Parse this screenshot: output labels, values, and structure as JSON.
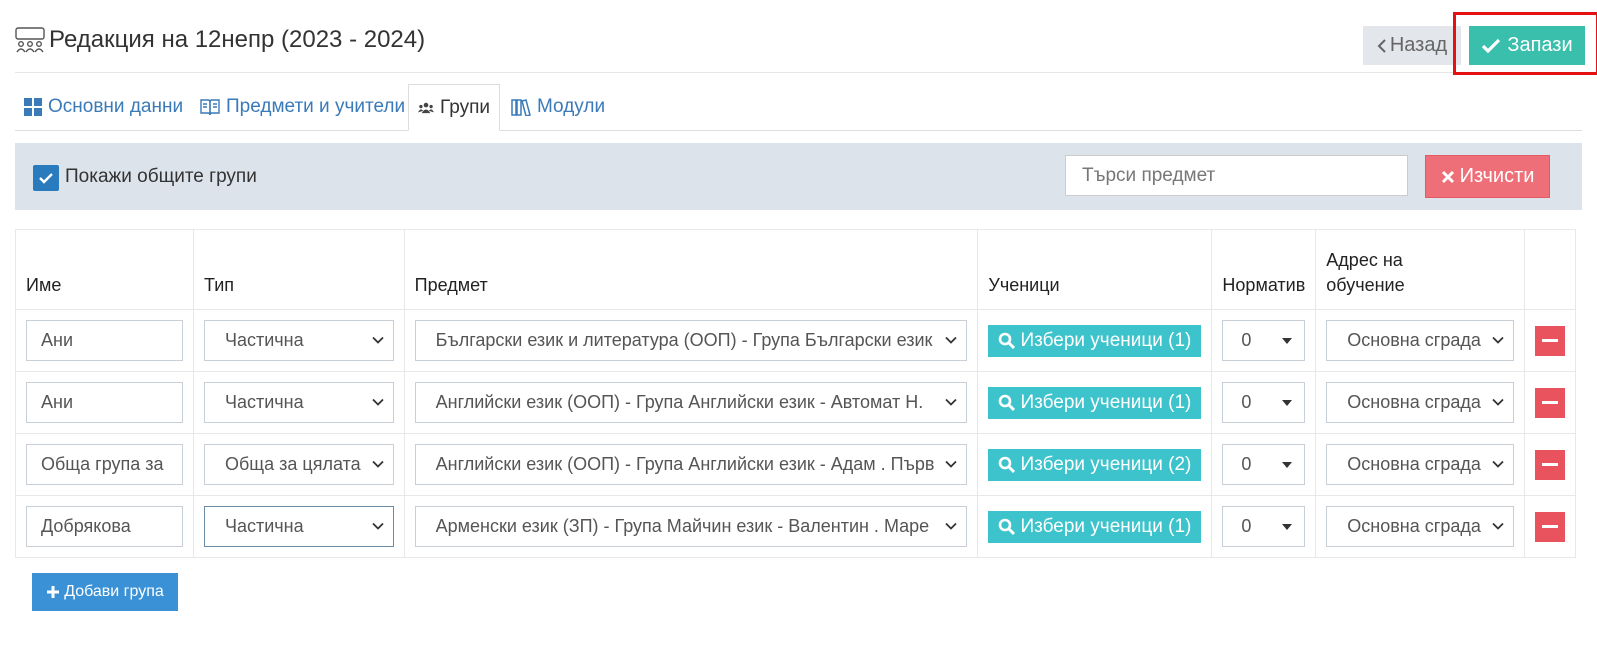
{
  "header": {
    "title": "Редакция на 12непр (2023 - 2024)",
    "back_label": "Назад",
    "save_label": "Запази"
  },
  "tabs": [
    {
      "label": "Основни данни",
      "icon": "grid-icon",
      "active": false
    },
    {
      "label": "Предмети и учители",
      "icon": "book-icon",
      "active": false
    },
    {
      "label": "Групи",
      "icon": "users-icon",
      "active": true
    },
    {
      "label": "Модули",
      "icon": "books-icon",
      "active": false
    }
  ],
  "filters": {
    "show_common_label": "Покажи общите групи",
    "show_common_checked": true,
    "search_placeholder": "Търси предмет",
    "clear_label": "Изчисти"
  },
  "table": {
    "headers": {
      "name": "Име",
      "type": "Тип",
      "subject": "Предмет",
      "students": "Ученици",
      "norm": "Норматив",
      "address_line1": "Адрес на",
      "address_line2": "обучение"
    },
    "rows": [
      {
        "name": "Ани",
        "type": "Частична",
        "subject": "Български език и литература (ООП) - Група Български език",
        "students": "Избери ученици (1)",
        "norm": "0",
        "address": "Основна сграда"
      },
      {
        "name": "Ани",
        "type": "Частична",
        "subject": "Английски език (ООП) - Група Английски език - Автомат Н.",
        "students": "Избери ученици (1)",
        "norm": "0",
        "address": "Основна сграда"
      },
      {
        "name": "Обща група за",
        "type": "Обща за цялата",
        "subject": "Английски език (ООП) - Група Английски език - Адам . Първ",
        "students": "Избери ученици (2)",
        "norm": "0",
        "address": "Основна сграда"
      },
      {
        "name": "Добрякова",
        "type": "Частична",
        "subject": "Арменски език (ЗП) - Група Майчин език - Валентин . Маре",
        "students": "Избери ученици (1)",
        "norm": "0",
        "address": "Основна сграда"
      }
    ]
  },
  "add_group_label": "Добави група",
  "colors": {
    "save": "#3bbfad",
    "clear": "#ef6f78",
    "students": "#3dc3cb",
    "remove": "#e8535e",
    "add": "#3a91d6",
    "link": "#3a7ab8",
    "highlight": "#e41212"
  }
}
